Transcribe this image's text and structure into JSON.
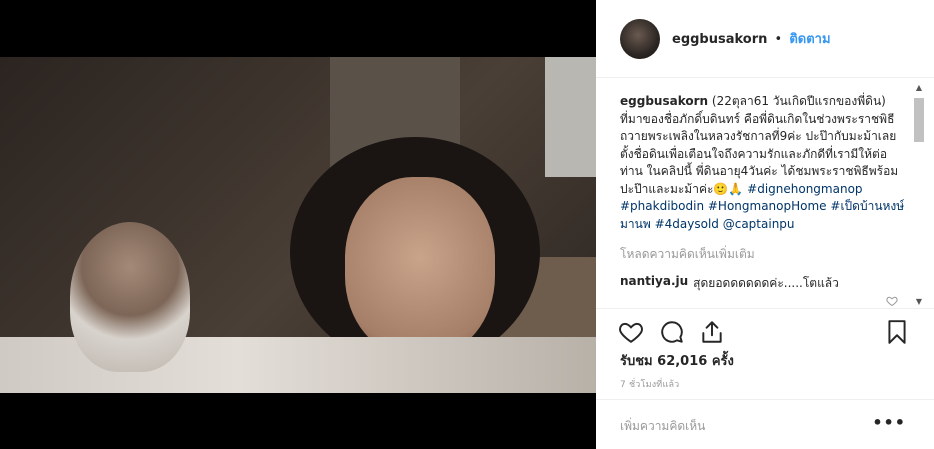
{
  "post": {
    "username": "eggbusakorn",
    "separator": "•",
    "follow_label": "ติดตาม"
  },
  "caption": {
    "username": "eggbusakorn",
    "text": "(22ตุลา61 วันเกิดปีแรกของพี่ดิน) ที่มาของชื่อภักดิ์บดินทร์ คือพี่ดินเกิดในช่วงพระราชพิธีถวายพระเพลิงในหลวงรัชกาลที่9ค่ะ ปะป๊ากับมะม้าเลยตั้งชื่อดินเพื่อเตือนใจถึงความรักและภักดีที่เรามีให้ต่อท่าน ในคลิปนี้ พี่ดินอายุ4วันค่ะ ได้ชมพระราชพิธีพร้อมปะป๊าและมะม้าค่ะ🙂🙏",
    "tags": [
      "#dignehongmanop",
      "#phakdibodin",
      "#HongmanopHome",
      "#เป็ดบ้านหงษ์มานพ",
      "#4daysold",
      "@captainpu"
    ]
  },
  "load_more_label": "โหลดความคิดเห็นเพิ่มเติม",
  "comments": [
    {
      "username": "nantiya.ju",
      "text": "สุดยอดดดดดดค่ะ.....โตแล้ว"
    }
  ],
  "likes_text": "รับชม 62,016 ครั้ง",
  "time_text": "7 ชั่วโมงที่แล้ว",
  "add_comment_placeholder": "เพิ่มความคิดเห็น",
  "more_label": "•••",
  "icons": {
    "like": "heart-icon",
    "comment": "comment-icon",
    "share": "share-icon",
    "save": "bookmark-icon"
  },
  "colors": {
    "follow": "#3897f0",
    "hashtag": "#003569",
    "muted": "#999999"
  }
}
